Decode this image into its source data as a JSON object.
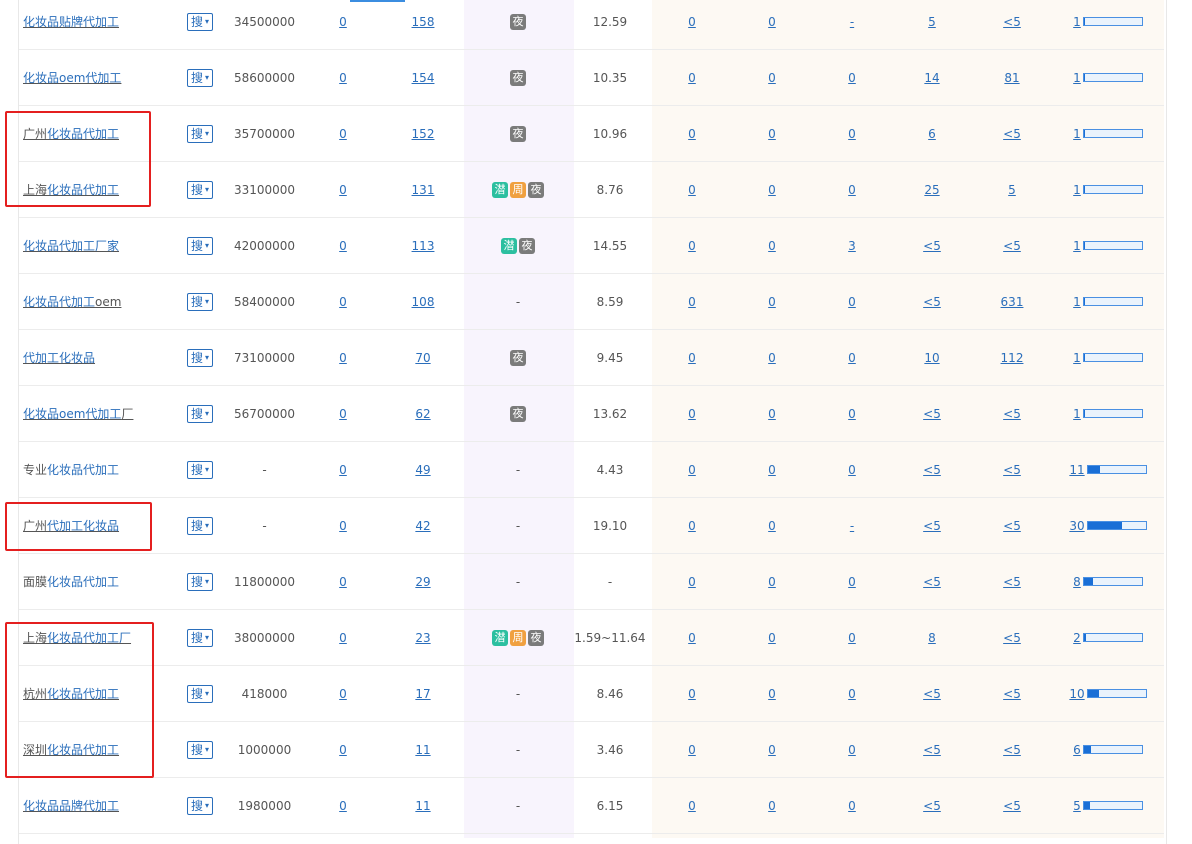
{
  "search_button": {
    "label": "搜",
    "caret": "▾"
  },
  "badges": {
    "ye": "夜",
    "qian": "潜",
    "zhou": "周"
  },
  "rows": [
    {
      "kw": [
        {
          "t": "化妆品贴牌代加工",
          "h": true
        }
      ],
      "link": true,
      "idx": "34500000",
      "c1": "0",
      "c2": "158",
      "tags": [
        "ye"
      ],
      "price": "12.59",
      "c3": "0",
      "c4": "0",
      "c5": "-",
      "c6": "5",
      "c7": "<5",
      "trend": "1",
      "trend_fraction": 0.02
    },
    {
      "kw": [
        {
          "t": "化妆品oem代加工",
          "h": true
        }
      ],
      "link": true,
      "idx": "58600000",
      "c1": "0",
      "c2": "154",
      "tags": [
        "ye"
      ],
      "price": "10.35",
      "c3": "0",
      "c4": "0",
      "c5": "0",
      "c6": "14",
      "c7": "81",
      "trend": "1",
      "trend_fraction": 0.02
    },
    {
      "kw": [
        {
          "t": "广州",
          "h": false
        },
        {
          "t": "化妆品代加工",
          "h": true
        }
      ],
      "link": true,
      "idx": "35700000",
      "c1": "0",
      "c2": "152",
      "tags": [
        "ye"
      ],
      "price": "10.96",
      "c3": "0",
      "c4": "0",
      "c5": "0",
      "c6": "6",
      "c7": "<5",
      "trend": "1",
      "trend_fraction": 0.02
    },
    {
      "kw": [
        {
          "t": "上海",
          "h": false
        },
        {
          "t": "化妆品代加工",
          "h": true
        }
      ],
      "link": true,
      "idx": "33100000",
      "c1": "0",
      "c2": "131",
      "tags": [
        "qian",
        "zhou",
        "ye"
      ],
      "price": "8.76",
      "c3": "0",
      "c4": "0",
      "c5": "0",
      "c6": "25",
      "c7": "5",
      "trend": "1",
      "trend_fraction": 0.02
    },
    {
      "kw": [
        {
          "t": "化妆品代加工厂家",
          "h": true
        }
      ],
      "link": true,
      "idx": "42000000",
      "c1": "0",
      "c2": "113",
      "tags": [
        "qian",
        "ye"
      ],
      "price": "14.55",
      "c3": "0",
      "c4": "0",
      "c5": "3",
      "c6": "<5",
      "c7": "<5",
      "trend": "1",
      "trend_fraction": 0.02
    },
    {
      "kw": [
        {
          "t": "化妆品代加工",
          "h": true
        },
        {
          "t": "oem",
          "h": false
        }
      ],
      "link": true,
      "idx": "58400000",
      "c1": "0",
      "c2": "108",
      "tags": [],
      "price": "8.59",
      "c3": "0",
      "c4": "0",
      "c5": "0",
      "c6": "<5",
      "c7": "631",
      "trend": "1",
      "trend_fraction": 0.02
    },
    {
      "kw": [
        {
          "t": "代加工化妆品",
          "h": true
        }
      ],
      "link": true,
      "idx": "73100000",
      "c1": "0",
      "c2": "70",
      "tags": [
        "ye"
      ],
      "price": "9.45",
      "c3": "0",
      "c4": "0",
      "c5": "0",
      "c6": "10",
      "c7": "112",
      "trend": "1",
      "trend_fraction": 0.02
    },
    {
      "kw": [
        {
          "t": "化妆品oem代加工",
          "h": true
        },
        {
          "t": "厂",
          "h": false
        }
      ],
      "link": true,
      "idx": "56700000",
      "c1": "0",
      "c2": "62",
      "tags": [
        "ye"
      ],
      "price": "13.62",
      "c3": "0",
      "c4": "0",
      "c5": "0",
      "c6": "<5",
      "c7": "<5",
      "trend": "1",
      "trend_fraction": 0.02
    },
    {
      "kw": [
        {
          "t": "专业",
          "h": false
        },
        {
          "t": "化妆品代加工",
          "h": true
        }
      ],
      "link": false,
      "idx": "-",
      "c1": "0",
      "c2": "49",
      "tags": [],
      "price": "4.43",
      "c3": "0",
      "c4": "0",
      "c5": "0",
      "c6": "<5",
      "c7": "<5",
      "trend": "11",
      "trend_fraction": 0.22
    },
    {
      "kw": [
        {
          "t": "广州",
          "h": false
        },
        {
          "t": "代加工化妆品",
          "h": true
        }
      ],
      "link": true,
      "idx": "-",
      "c1": "0",
      "c2": "42",
      "tags": [],
      "price": "19.10",
      "c3": "0",
      "c4": "0",
      "c5": "-",
      "c6": "<5",
      "c7": "<5",
      "trend": "30",
      "trend_fraction": 0.6
    },
    {
      "kw": [
        {
          "t": "面膜",
          "h": false
        },
        {
          "t": "化妆品代加工",
          "h": true
        }
      ],
      "link": false,
      "idx": "11800000",
      "c1": "0",
      "c2": "29",
      "tags": [],
      "price": "-",
      "c3": "0",
      "c4": "0",
      "c5": "0",
      "c6": "<5",
      "c7": "<5",
      "trend": "8",
      "trend_fraction": 0.16
    },
    {
      "kw": [
        {
          "t": "上海",
          "h": false
        },
        {
          "t": "化妆品代加工厂",
          "h": true
        }
      ],
      "link": true,
      "idx": "38000000",
      "c1": "0",
      "c2": "23",
      "tags": [
        "qian",
        "zhou",
        "ye"
      ],
      "price": "1.59~11.64",
      "c3": "0",
      "c4": "0",
      "c5": "0",
      "c6": "8",
      "c7": "<5",
      "trend": "2",
      "trend_fraction": 0.04
    },
    {
      "kw": [
        {
          "t": "杭州",
          "h": false
        },
        {
          "t": "化妆品代加工",
          "h": true
        }
      ],
      "link": true,
      "idx": "418000",
      "c1": "0",
      "c2": "17",
      "tags": [],
      "price": "8.46",
      "c3": "0",
      "c4": "0",
      "c5": "0",
      "c6": "<5",
      "c7": "<5",
      "trend": "10",
      "trend_fraction": 0.2
    },
    {
      "kw": [
        {
          "t": "深圳",
          "h": false
        },
        {
          "t": "化妆品代加工",
          "h": true
        }
      ],
      "link": true,
      "idx": "1000000",
      "c1": "0",
      "c2": "11",
      "tags": [],
      "price": "3.46",
      "c3": "0",
      "c4": "0",
      "c5": "0",
      "c6": "<5",
      "c7": "<5",
      "trend": "6",
      "trend_fraction": 0.12
    },
    {
      "kw": [
        {
          "t": "化妆品品牌代加工",
          "h": true
        }
      ],
      "link": true,
      "idx": "1980000",
      "c1": "0",
      "c2": "11",
      "tags": [],
      "price": "6.15",
      "c3": "0",
      "c4": "0",
      "c5": "0",
      "c6": "<5",
      "c7": "<5",
      "trend": "5",
      "trend_fraction": 0.1
    }
  ],
  "empty_value": "-",
  "highlight_color": "#e41f1f"
}
